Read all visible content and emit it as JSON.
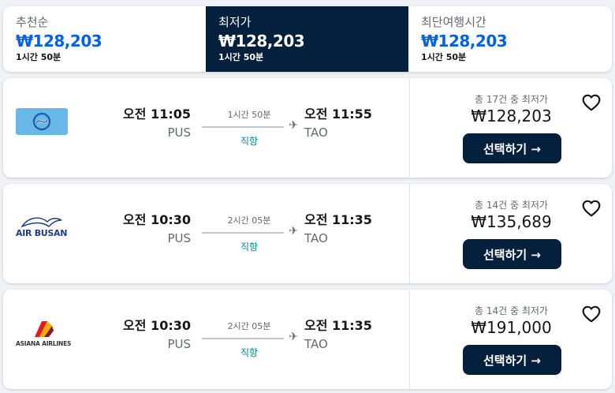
{
  "sort_tabs": [
    {
      "label": "추천순",
      "price": "₩128,203",
      "duration": "1시간 50분",
      "active": false
    },
    {
      "label": "최저가",
      "price": "₩128,203",
      "duration": "1시간 50분",
      "active": true
    },
    {
      "label": "최단여행시간",
      "price": "₩128,203",
      "duration": "1시간 50분",
      "active": false
    }
  ],
  "results": [
    {
      "airline": "",
      "logo": "generic-airline-logo",
      "dep_time": "오전 11:05",
      "dep_code": "PUS",
      "duration": "1시간 50분",
      "stops": "직항",
      "arr_time": "오전 11:55",
      "arr_code": "TAO",
      "offers": "총 17건 중 최저가",
      "price": "₩128,203",
      "select": "선택하기 →"
    },
    {
      "airline": "AIR BUSAN",
      "logo": "air-busan-logo",
      "dep_time": "오전 10:30",
      "dep_code": "PUS",
      "duration": "2시간 05분",
      "stops": "직항",
      "arr_time": "오전 11:35",
      "arr_code": "TAO",
      "offers": "총 14건 중 최저가",
      "price": "₩135,689",
      "select": "선택하기 →"
    },
    {
      "airline": "ASIANA AIRLINES",
      "logo": "asiana-airlines-logo",
      "dep_time": "오전 10:30",
      "dep_code": "PUS",
      "duration": "2시간 05분",
      "stops": "직항",
      "arr_time": "오전 11:35",
      "arr_code": "TAO",
      "offers": "총 14건 중 최저가",
      "price": "₩191,000",
      "select": "선택하기 →"
    }
  ],
  "colors": {
    "brand_dark": "#05203c",
    "accent_blue": "#0062e3",
    "direct_teal": "#0c838a"
  }
}
